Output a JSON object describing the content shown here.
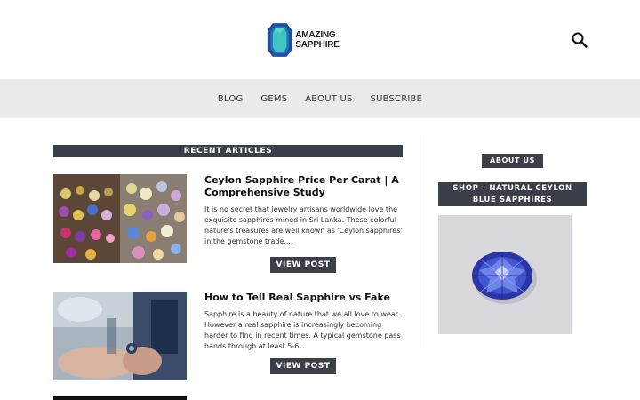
{
  "header": {
    "brand": "AMAZING SAPPHIRE",
    "logo_icon": "sapphire-gem-logo",
    "search_icon": "search-icon"
  },
  "nav": {
    "items": [
      {
        "label": "BLOG"
      },
      {
        "label": "GEMS"
      },
      {
        "label": "ABOUT US"
      },
      {
        "label": "SUBSCRIBE"
      }
    ]
  },
  "main": {
    "section_title": "RECENT ARTICLES",
    "articles": [
      {
        "title": "Ceylon Sapphire Price Per Carat | A Comprehensive Study",
        "excerpt": "It is no secret that jewelry artisans worldwide love the exquisite sapphires mined in Sri Lanka. These colorful nature's treasures are well known as 'Ceylon sapphires' in the gemstone trade....",
        "button": "VIEW POST"
      },
      {
        "title": "How to Tell Real Sapphire vs Fake",
        "excerpt": "Sapphire is a beauty of nature that we all love to wear. However a real sapphire is increasingly becoming harder to find in recent times. A typical gemstone pass hands through at least 5-6...",
        "button": "VIEW POST"
      }
    ]
  },
  "sidebar": {
    "about_label": "ABOUT US",
    "shop_line1": "SHOP – NATURAL CEYLON",
    "shop_line2": "BLUE SAPPHIRES"
  },
  "colors": {
    "dark_bar": "#3b3f47",
    "nav_bg": "#ebebeb",
    "logo_blue": "#1f4f9c",
    "logo_teal": "#3cc8c0"
  }
}
